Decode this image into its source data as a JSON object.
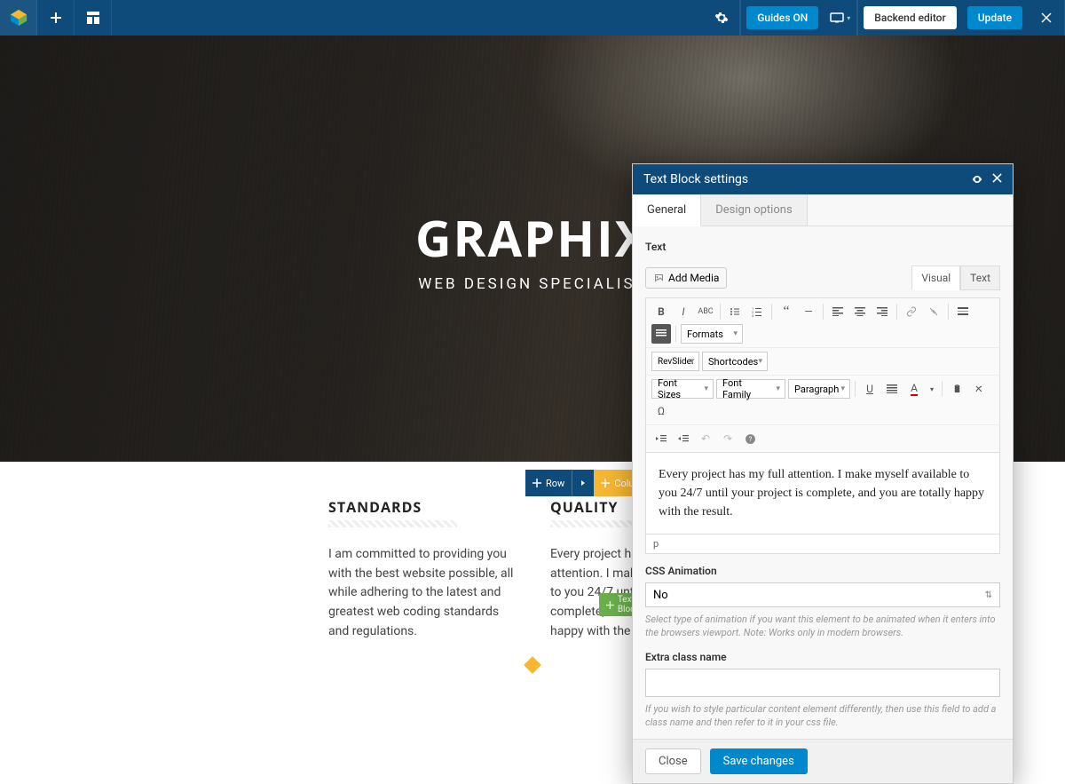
{
  "topbar": {
    "guides_label": "Guides ON",
    "backend_label": "Backend editor",
    "update_label": "Update"
  },
  "hero": {
    "title": "GRAPHIX",
    "subtitle": "WEB DESIGN SPECIALIST"
  },
  "columns": [
    {
      "heading": "STANDARDS",
      "body": "I am committed to providing you with the best website possible, all while adhering to the latest and greatest web coding standards and regulations."
    },
    {
      "heading": "QUALITY",
      "body": "Every project has my full attention. I make myself available to you 24/7 until your project is complete, and you are totally happy with the result."
    }
  ],
  "row_controls": {
    "row_label": "Row",
    "col_label": "Column"
  },
  "textblock_label": "Text Block",
  "panel": {
    "title": "Text Block settings",
    "tabs": {
      "general": "General",
      "design": "Design options"
    },
    "text_label": "Text",
    "add_media": "Add Media",
    "visual_tab": "Visual",
    "text_tab": "Text",
    "formats": "Formats",
    "revslider": "RevSlider",
    "shortcodes": "Shortcodes",
    "font_sizes": "Font Sizes",
    "font_family": "Font Family",
    "paragraph": "Paragraph",
    "editor_content": "Every project has my full attention. I make myself available to you 24/7 until your project is complete, and you are totally happy with the result.",
    "status_path": "p",
    "css_anim_label": "CSS Animation",
    "css_anim_value": "No",
    "css_anim_hint": "Select type of animation if you want this element to be animated when it enters into the browsers viewport. Note: Works only in modern browsers.",
    "extra_class_label": "Extra class name",
    "extra_class_hint": "If you wish to style particular content element differently, then use this field to add a class name and then refer to it in your css file.",
    "close": "Close",
    "save": "Save changes"
  }
}
